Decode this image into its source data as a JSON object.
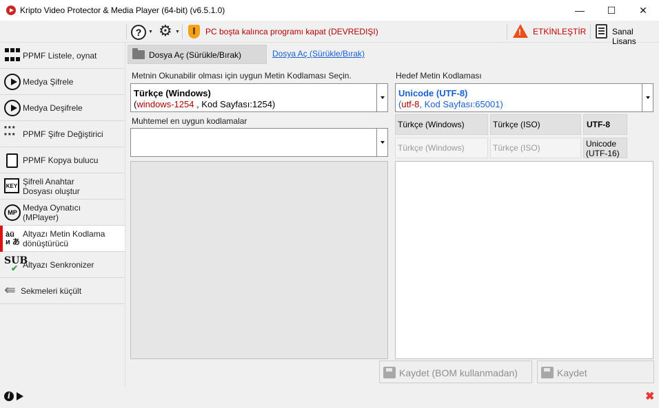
{
  "window": {
    "title": "Kripto Video Protector & Media Player (64-bit) (v6.5.1.0)",
    "minimize": "—",
    "maximize": "☐",
    "close": "✕"
  },
  "toolbar": {
    "pc_close_label": "PC boşta kalınca programı kapat (DEVREDIŞI)",
    "activate_label": "ETKİNLEŞTİR",
    "license_label": "Sanal Lisans",
    "help_glyph": "?",
    "gear_glyph": "⚙",
    "warn_glyph": "!"
  },
  "sidebar": {
    "items": [
      {
        "label": "PPMF Listele, oynat",
        "icon": "grid-icon"
      },
      {
        "label": "Medya Şifrele",
        "icon": "play-circle-icon"
      },
      {
        "label": "Medya Deşifrele",
        "icon": "play-circle-icon"
      },
      {
        "label": "PPMF Şifre Değiştirici",
        "icon": "password-stars-icon",
        "glyph": "***\n***"
      },
      {
        "label": "PPMF Kopya bulucu",
        "icon": "copy-icon"
      },
      {
        "label": "Şifreli Anahtar\nDosyası oluştur",
        "icon": "key-icon",
        "glyph": "KEY"
      },
      {
        "label": "Medya Oynatıcı\n(MPlayer)",
        "icon": "mplayer-icon",
        "glyph": "MP"
      },
      {
        "label": "Altyazı Metin Kodlama\ndönüştürücü",
        "icon": "encoding-chars-icon",
        "glyph": "àü\nи あ"
      },
      {
        "label": "Altyazı Senkronizer",
        "icon": "sub-sync-icon",
        "glyph": "SUB"
      },
      {
        "label": "Sekmeleri küçült",
        "icon": "collapse-arrow-icon",
        "glyph": "⇚"
      }
    ]
  },
  "footer": {
    "info_glyph": "i",
    "close_glyph": "✖"
  },
  "main": {
    "open_file_button": "Dosya Aç (Sürükle/Bırak)",
    "open_file_link": "Dosya Aç (Sürükle/Bırak)",
    "source": {
      "label": "Metnin Okunabilir olması için uygun Metin Kodlaması Seçin.",
      "encoding_name": "Türkçe (Windows)",
      "encoding_code": "windows-1254",
      "encoding_page": " , Kod Sayfası:1254)",
      "encoding_open_paren": "(",
      "likely_label": "Muhtemel en uygun kodlamalar",
      "likely_value": ""
    },
    "target": {
      "label": "Hedef Metin Kodlaması",
      "encoding_name": "Unicode (UTF-8)",
      "encoding_code": "utf-8",
      "encoding_page": "Kod Sayfası:65001)",
      "encoding_open_paren": "(",
      "encoding_sep": ", ",
      "quick_row1": [
        "Türkçe (Windows)",
        "Türkçe (ISO)",
        "UTF-8"
      ],
      "quick_row2": [
        "Türkçe (Windows)",
        "Türkçe (ISO)",
        "Unicode\n(UTF-16)"
      ]
    },
    "save_no_bom": "Kaydet (BOM kullanmadan)",
    "save": "Kaydet"
  },
  "colors": {
    "red_text": "#b00000",
    "blue_text": "#1a5fd1",
    "active_marker": "#dd1111"
  }
}
